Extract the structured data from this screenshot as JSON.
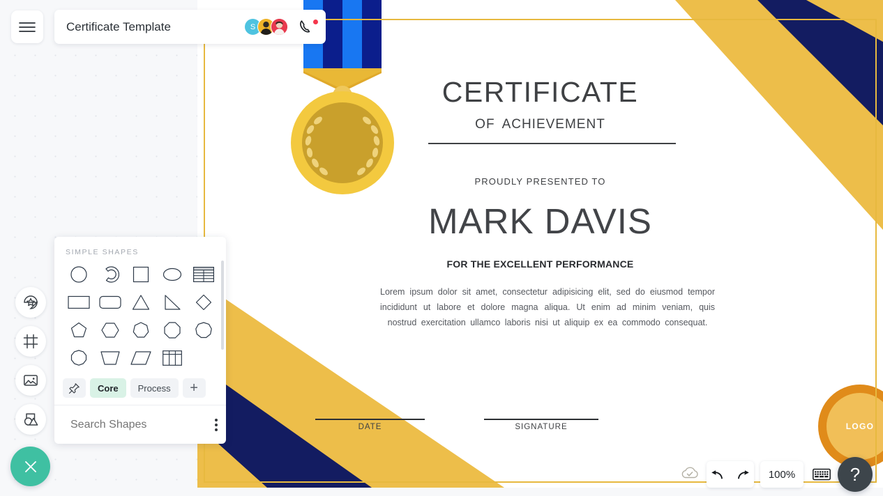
{
  "app": {
    "colors": {
      "gold": "#EDBE4A",
      "navy": "#131C61",
      "gold_border": "#E7B93F",
      "accent_green": "#3FC0A2",
      "tab_active_bg": "#D9F2E6",
      "logo_ring": "#E08B1A",
      "logo_fill": "#F1BF58",
      "notification_red": "#F4364C"
    }
  },
  "topbar": {
    "menu_icon": "hamburger-icon",
    "document_title": "Certificate Template",
    "collaborators": [
      {
        "name": "S",
        "type": "initial",
        "bg": "#4EC3E0"
      },
      {
        "name": "",
        "type": "photo",
        "bg": "#F0B429"
      },
      {
        "name": "",
        "type": "photo",
        "bg": "#E83A4E"
      }
    ],
    "call_icon": "phone-call-icon",
    "call_badge": true
  },
  "left_rail": {
    "items": [
      {
        "icon": "shape-style-icon",
        "label": "Styles"
      },
      {
        "icon": "frame-icon",
        "label": "Frames"
      },
      {
        "icon": "image-icon",
        "label": "Images"
      },
      {
        "icon": "shapes-icon",
        "label": "Shapes"
      }
    ],
    "close_button": {
      "icon": "close-icon",
      "label": "Close"
    }
  },
  "shapes_panel": {
    "header": "SIMPLE SHAPES",
    "shapes": [
      {
        "name": "circle"
      },
      {
        "name": "arc"
      },
      {
        "name": "square"
      },
      {
        "name": "ellipse"
      },
      {
        "name": "table-striped"
      },
      {
        "name": "rectangle"
      },
      {
        "name": "rounded-rectangle"
      },
      {
        "name": "triangle"
      },
      {
        "name": "right-triangle"
      },
      {
        "name": "diamond"
      },
      {
        "name": "pentagon"
      },
      {
        "name": "hexagon"
      },
      {
        "name": "heptagon"
      },
      {
        "name": "octagon"
      },
      {
        "name": "nonagon"
      },
      {
        "name": "decagon"
      },
      {
        "name": "trapezoid"
      },
      {
        "name": "parallelogram"
      },
      {
        "name": "grid-table"
      }
    ],
    "tabs": [
      {
        "label": "",
        "icon": "pin-icon",
        "active": false,
        "kind": "pin"
      },
      {
        "label": "Core",
        "active": true,
        "kind": "text"
      },
      {
        "label": "Process",
        "active": false,
        "kind": "text"
      },
      {
        "label": "+",
        "active": false,
        "kind": "plus"
      }
    ],
    "search": {
      "placeholder": "Search Shapes",
      "value": "",
      "icon": "search-icon",
      "menu_icon": "kebab-menu-icon"
    }
  },
  "certificate": {
    "title": "CERTIFICATE",
    "subtitle_of": "OF",
    "subtitle_type": "ACHIEVEMENT",
    "presented_label": "PROUDLY PRESENTED TO",
    "recipient": "MARK DAVIS",
    "reason": "FOR THE EXCELLENT PERFORMANCE",
    "body": "Lorem ipsum dolor sit amet, consectetur adipisicing elit, sed do eiusmod tempor incididunt ut labore et dolore magna aliqua. Ut enim ad minim veniam, quis nostrud exercitation ullamco laboris nisi ut aliquip ex ea commodo consequat.",
    "date_label": "DATE",
    "signature_label": "SIGNATURE",
    "logo_text": "LOGO",
    "medal_icon": "award-medal-icon"
  },
  "bottom_toolbar": {
    "save_status_icon": "cloud-saved-icon",
    "undo_icon": "undo-icon",
    "redo_icon": "redo-icon",
    "zoom_level": "100%",
    "keyboard_icon": "keyboard-icon",
    "help_label": "?"
  }
}
